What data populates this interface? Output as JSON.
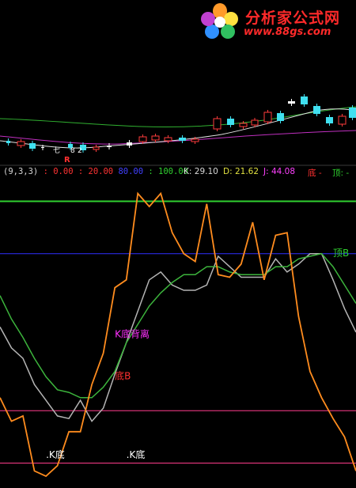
{
  "logo": {
    "title": "分析家公式网",
    "url": "www.88gs.com"
  },
  "price_panel": {
    "r_marker": "R",
    "candle_labels": [
      "七",
      "8",
      "2"
    ]
  },
  "indicator_header": {
    "params": "(9,3,3)",
    "levels": [
      {
        "text": ": 0.00",
        "color": "#ff3333"
      },
      {
        "text": ": 20.00",
        "color": "#ff3333"
      },
      {
        "text": "80.00",
        "color": "#4040ff"
      },
      {
        "text": ": 100.00",
        "color": "#30d030"
      }
    ],
    "k_text": "K: 29.10",
    "d_text": "D: 21.62",
    "j_text": "J: 44.08",
    "di_text": "底 -",
    "ding_text": "顶: -"
  },
  "colors": {
    "k_line": "#b4b4b4",
    "d_line": "#3cb43c",
    "j_line": "#ff8c1e",
    "level_100": "#30d030",
    "level_80": "#3030ff",
    "level_20": "#ff3c8c",
    "level_0": "#ff3c8c",
    "bull_candle": "#ff3c3c",
    "bear_candle": "#40e0f0",
    "ma_green": "#30b030",
    "ma_magenta": "#c030c0",
    "ma_white": "#e0e0e0"
  },
  "chart_data": {
    "type": "line",
    "title": "",
    "indicator": "KDJ",
    "ylim": [
      -8,
      108
    ],
    "x_count": 31,
    "reference_lines": [
      {
        "value": 100,
        "color": "#30d030"
      },
      {
        "value": 80,
        "color": "#3030ff"
      },
      {
        "value": 20,
        "color": "#ff3c8c"
      },
      {
        "value": 0,
        "color": "#ff3c8c"
      }
    ],
    "series": [
      {
        "name": "K",
        "values": [
          52,
          44,
          40,
          30,
          24,
          18,
          17,
          24,
          16,
          21,
          34,
          46,
          58,
          70,
          73,
          68,
          66,
          66,
          68,
          79,
          75,
          71,
          71,
          71,
          78,
          73,
          76,
          80,
          80,
          70,
          59,
          50
        ]
      },
      {
        "name": "D",
        "values": [
          64,
          55,
          48,
          40,
          33,
          28,
          27,
          25,
          25,
          29,
          35,
          46,
          53,
          60,
          65,
          69,
          72,
          72,
          75,
          75,
          73,
          72,
          72,
          72,
          75,
          75,
          78,
          79,
          80,
          75,
          68,
          61
        ]
      },
      {
        "name": "J",
        "values": [
          25,
          16,
          18,
          -3,
          -5,
          -1,
          12,
          12,
          30,
          42,
          67,
          70,
          103,
          98,
          103,
          88,
          80,
          77,
          99,
          72,
          71,
          76,
          92,
          70,
          87,
          88,
          56,
          35,
          25,
          17,
          10,
          -3
        ]
      }
    ],
    "annotations": [
      {
        "text": "K底背离",
        "x": 10,
        "y": 48,
        "color": "#ff30ff"
      },
      {
        "text": "底B",
        "x": 10,
        "y": 32,
        "color": "#ff3030"
      },
      {
        "text": "顶B",
        "x": 29,
        "y": 79,
        "color": "#30d030"
      },
      {
        "text": ".K底",
        "x": 4,
        "y": 2,
        "color": "#ffffff"
      },
      {
        "text": ".K底",
        "x": 11,
        "y": 2,
        "color": "#ffffff"
      }
    ]
  }
}
